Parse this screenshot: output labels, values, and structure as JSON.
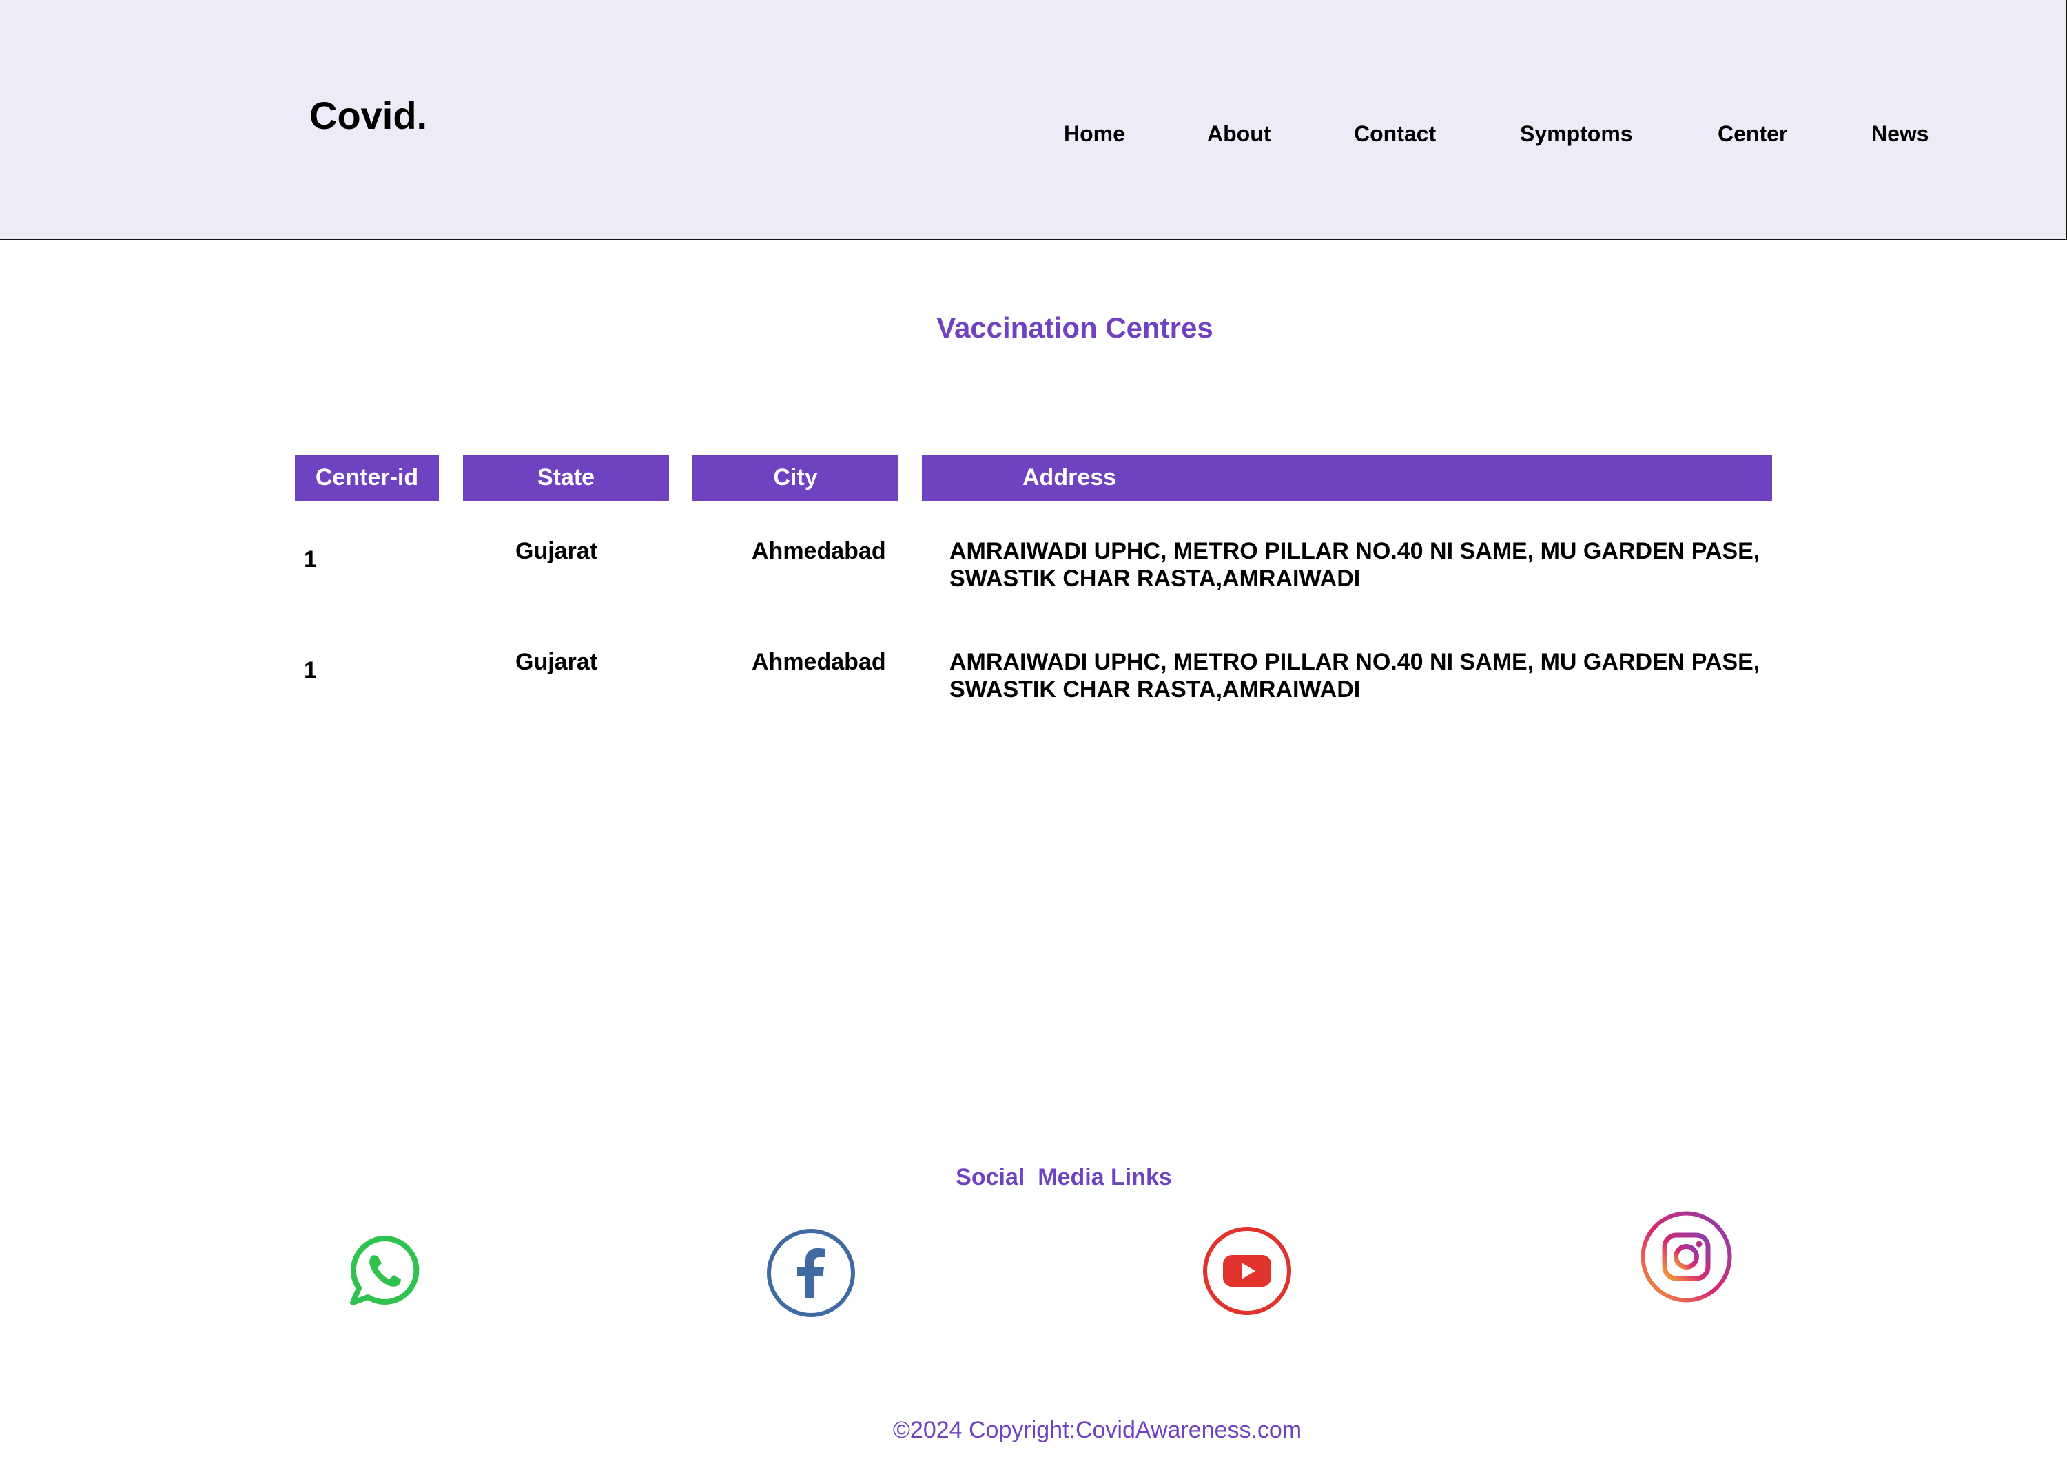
{
  "header": {
    "logo": "Covid.",
    "nav": [
      "Home",
      "About",
      "Contact",
      "Symptoms",
      "Center",
      "News"
    ]
  },
  "main": {
    "title": "Vaccination Centres",
    "table": {
      "columns": [
        "Center-id",
        "State",
        "City",
        "Address"
      ],
      "rows": [
        {
          "id": "1",
          "state": "Gujarat",
          "city": "Ahmedabad",
          "address": "AMRAIWADI UPHC, METRO PILLAR NO.40 NI SAME, MU GARDEN PASE, SWASTIK CHAR RASTA,AMRAIWADI"
        },
        {
          "id": "1",
          "state": "Gujarat",
          "city": "Ahmedabad",
          "address": "AMRAIWADI UPHC, METRO PILLAR NO.40 NI SAME, MU GARDEN PASE, SWASTIK CHAR RASTA,AMRAIWADI"
        }
      ]
    }
  },
  "social": {
    "title": "Social  Media Links",
    "icons": [
      "whatsapp-icon",
      "facebook-icon",
      "youtube-icon",
      "instagram-icon"
    ]
  },
  "footer": {
    "copyright": "©2024 Copyright:CovidAwareness.com"
  },
  "colors": {
    "header_bg": "#eeebf8",
    "accent": "#6e42c1",
    "whatsapp": "#2fc24f",
    "facebook": "#3f6aa3",
    "youtube": "#e1322c"
  }
}
